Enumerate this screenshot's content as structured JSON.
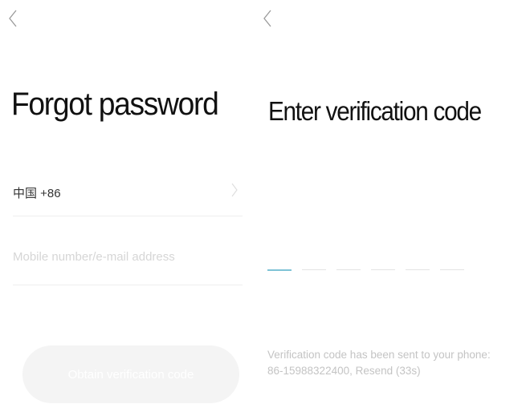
{
  "forgot_screen": {
    "back_icon": "chevron-left-icon",
    "title": "Forgot password",
    "country_code_label": "中国 +86",
    "country_chevron_icon": "chevron-right-icon",
    "account_input": {
      "value": "",
      "placeholder": "Mobile number/e-mail address"
    },
    "obtain_button_label": "Obtain verification code"
  },
  "verify_screen": {
    "back_icon": "chevron-left-icon",
    "title": "Enter verification code",
    "code_digit_count": 6,
    "active_digit": 1,
    "sent_message_line1": "Verification code has been sent to your phone:",
    "sent_message_line2": "86-15988322400, Resend (33s)"
  },
  "colors": {
    "title_text": "#111111",
    "placeholder_text": "#d6d6d6",
    "divider": "#eeeeee",
    "button_disabled_bg": "#f4f4f4",
    "active_slot": "#7fc3d6",
    "muted_text": "#c4c4c4"
  }
}
